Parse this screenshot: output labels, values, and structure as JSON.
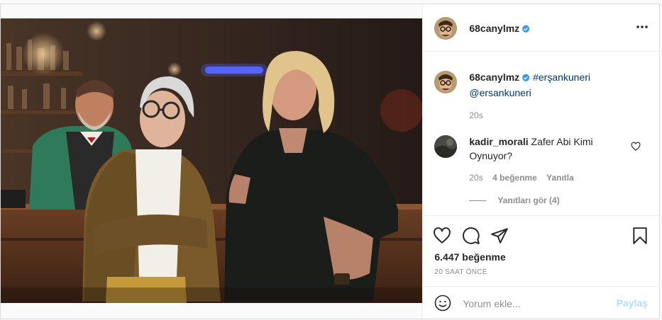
{
  "post": {
    "author": {
      "username": "68canylmz",
      "verified": true
    },
    "header": {
      "more_icon": "more-horizontal-icon"
    },
    "caption": {
      "username": "68canylmz",
      "hashtag": "#erşankuneri",
      "mention": "@ersankuneri",
      "time": "20s"
    },
    "comments": [
      {
        "username": "kadir_morali",
        "text": "Zafer Abi Kimi Oynuyor?",
        "time": "20s",
        "likes": "4 beğenme",
        "reply_label": "Yanıtla",
        "view_replies": "Yanıtları gör (4)"
      }
    ],
    "actions": {
      "icons": [
        "heart-icon",
        "comment-icon",
        "share-icon",
        "bookmark-icon"
      ]
    },
    "likes_text": "6.447 beğenme",
    "time_ago": "20 SAAT ÖNCE",
    "comment_box": {
      "placeholder": "Yorum ekle...",
      "post_label": "Paylaş"
    }
  },
  "colors": {
    "verified": "#3897f0",
    "link": "#00376b",
    "muted": "#8e8e8e",
    "post_disabled": "#b2dffc"
  }
}
